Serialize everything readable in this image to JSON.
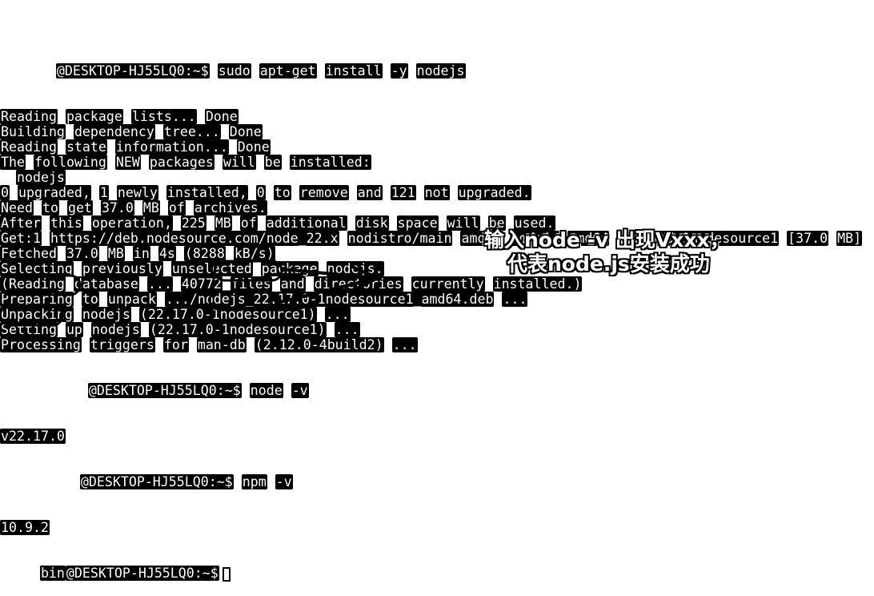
{
  "terminal": {
    "host_prompt": "@DESKTOP-HJ55LQ0:~$",
    "last_prompt_user_suffix": "bin",
    "command_install": "sudo apt-get install -y nodejs",
    "output": [
      "Reading package lists... Done",
      "Building dependency tree... Done",
      "Reading state information... Done",
      "The following NEW packages will be installed:",
      "  nodejs",
      "0 upgraded, 1 newly installed, 0 to remove and 121 not upgraded.",
      "Need to get 37.0 MB of archives.",
      "After this operation, 225 MB of additional disk space will be used.",
      "Get:1 https://deb.nodesource.com/node_22.x nodistro/main amd64 nodejs amd64 22.17.0-1nodesource1 [37.0 MB]",
      "Fetched 37.0 MB in 4s (8288 kB/s)",
      "Selecting previously unselected package nodejs.",
      "(Reading database ... 40772 files and directories currently installed.)",
      "Preparing to unpack .../nodejs_22.17.0-1nodesource1_amd64.deb ...",
      "Unpacking nodejs (22.17.0-1nodesource1) ...",
      "Setting up nodejs (22.17.0-1nodesource1) ...",
      "Processing triggers for man-db (2.12.0-4build2) ..."
    ],
    "command_node": "node -v",
    "node_version": "v22.17.0",
    "command_npm": "npm -v",
    "npm_version": "10.9.2"
  },
  "annotation": {
    "line1": "输入node -v 出现Vxxx，",
    "line2": "代表node.js安装成功"
  }
}
